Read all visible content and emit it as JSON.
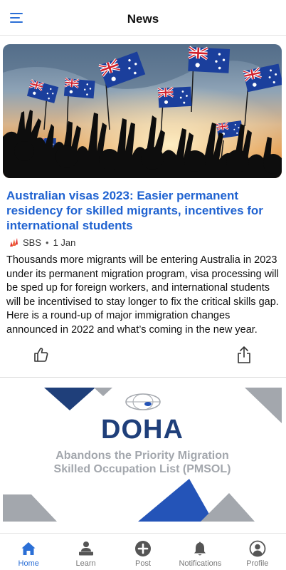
{
  "header": {
    "title": "News"
  },
  "article": {
    "title": "Australian visas 2023: Easier permanent residency for skilled migrants, incentives for international students",
    "source": "SBS",
    "date": "1 Jan",
    "separator": "•",
    "body": "Thousands more migrants will be entering Australia in 2023 under its permanent migration program, visa processing will be sped up for foreign workers, and international students will be incentivised to stay longer to fix the critical skills gap. Here is a round-up of major immigration changes announced in 2022 and what’s coming in the new year."
  },
  "promo": {
    "title": "DOHA",
    "subtitle_line1": "Abandons the Priority Migration",
    "subtitle_line2": "Skilled Occupation List (PMSOL)"
  },
  "tabs": [
    {
      "label": "Home",
      "icon": "home-icon",
      "active": true
    },
    {
      "label": "Learn",
      "icon": "learn-icon",
      "active": false
    },
    {
      "label": "Post",
      "icon": "post-icon",
      "active": false
    },
    {
      "label": "Notifications",
      "icon": "bell-icon",
      "active": false
    },
    {
      "label": "Profile",
      "icon": "profile-icon",
      "active": false
    }
  ],
  "colors": {
    "accent": "#2b6fd6",
    "title_link": "#2063d1",
    "promo_navy": "#1f3f7a",
    "promo_grey": "#a3a7ad",
    "inactive": "#777777"
  }
}
